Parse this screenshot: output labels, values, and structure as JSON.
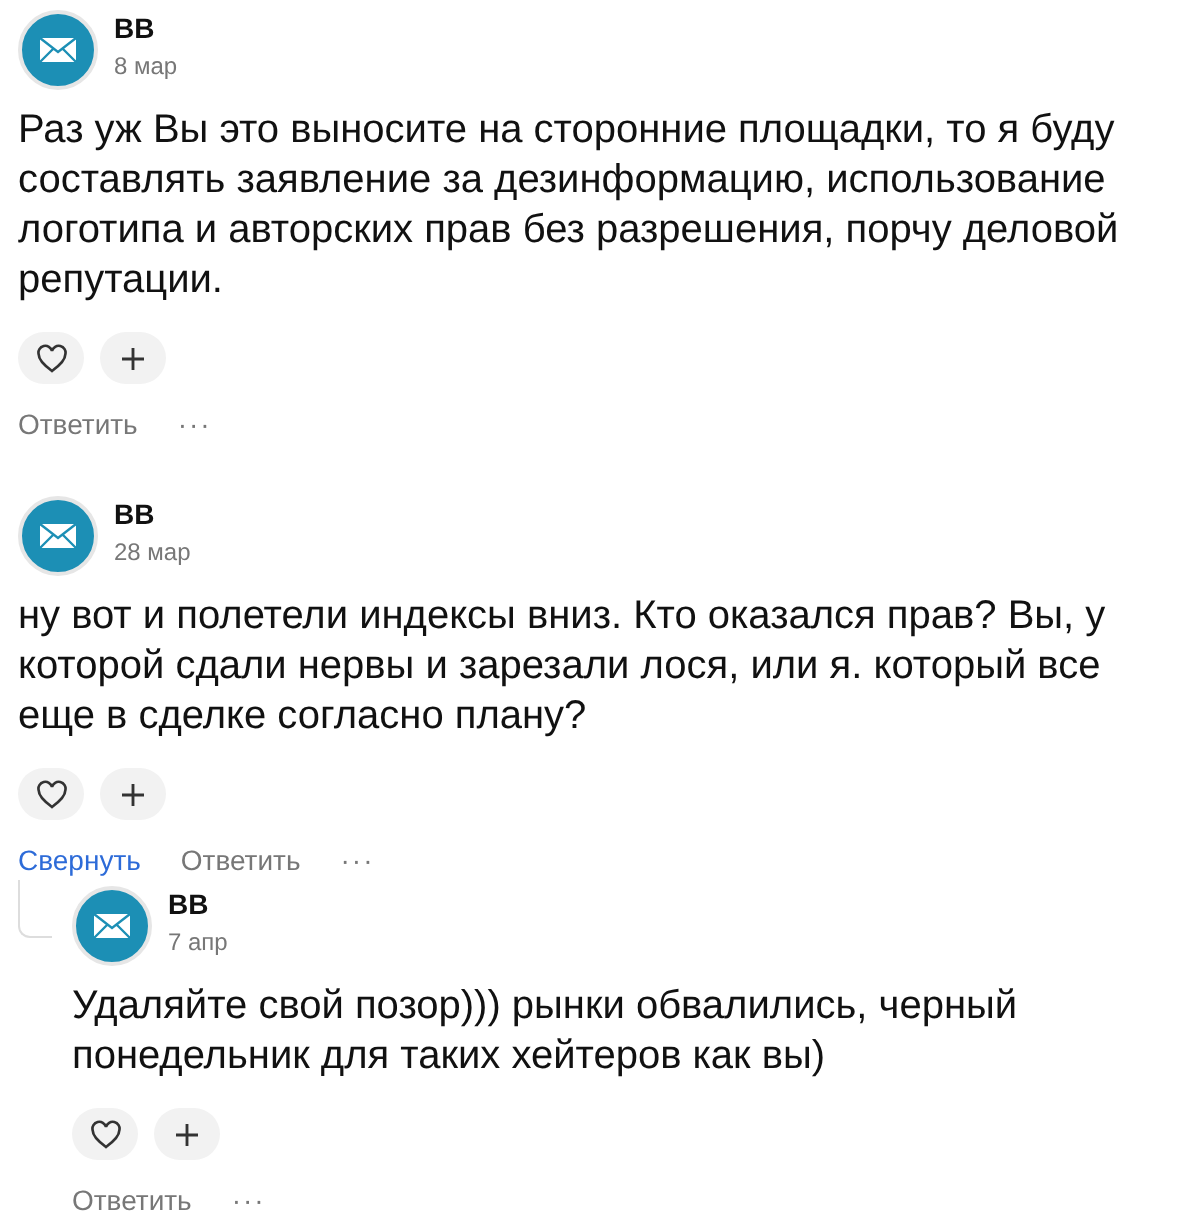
{
  "comments": [
    {
      "author": "BB",
      "date": "8 мар",
      "text": "Раз уж Вы это выносите на сторонние площадки, то я буду составлять заявление за дезинформацию, использование логотипа и авторских прав без разрешения, порчу деловой репутации.",
      "actions": [
        {
          "kind": "reply",
          "label": "Ответить"
        },
        {
          "kind": "more",
          "label": "···"
        }
      ]
    },
    {
      "author": "BB",
      "date": "28 мар",
      "text": "ну вот и полетели индексы вниз. Кто оказался прав? Вы, у которой сдали нервы и зарезали лося, или я. который все еще в сделке согласно плану?",
      "actions": [
        {
          "kind": "collapse",
          "label": "Свернуть"
        },
        {
          "kind": "reply",
          "label": "Ответить"
        },
        {
          "kind": "more",
          "label": "···"
        }
      ],
      "children": [
        {
          "author": "BB",
          "date": "7 апр",
          "text": "Удаляйте свой позор))) рынки обвалились, черный понедельник для таких хейтеров как вы)",
          "actions": [
            {
              "kind": "reply",
              "label": "Ответить"
            },
            {
              "kind": "more",
              "label": "···"
            }
          ]
        }
      ]
    }
  ]
}
